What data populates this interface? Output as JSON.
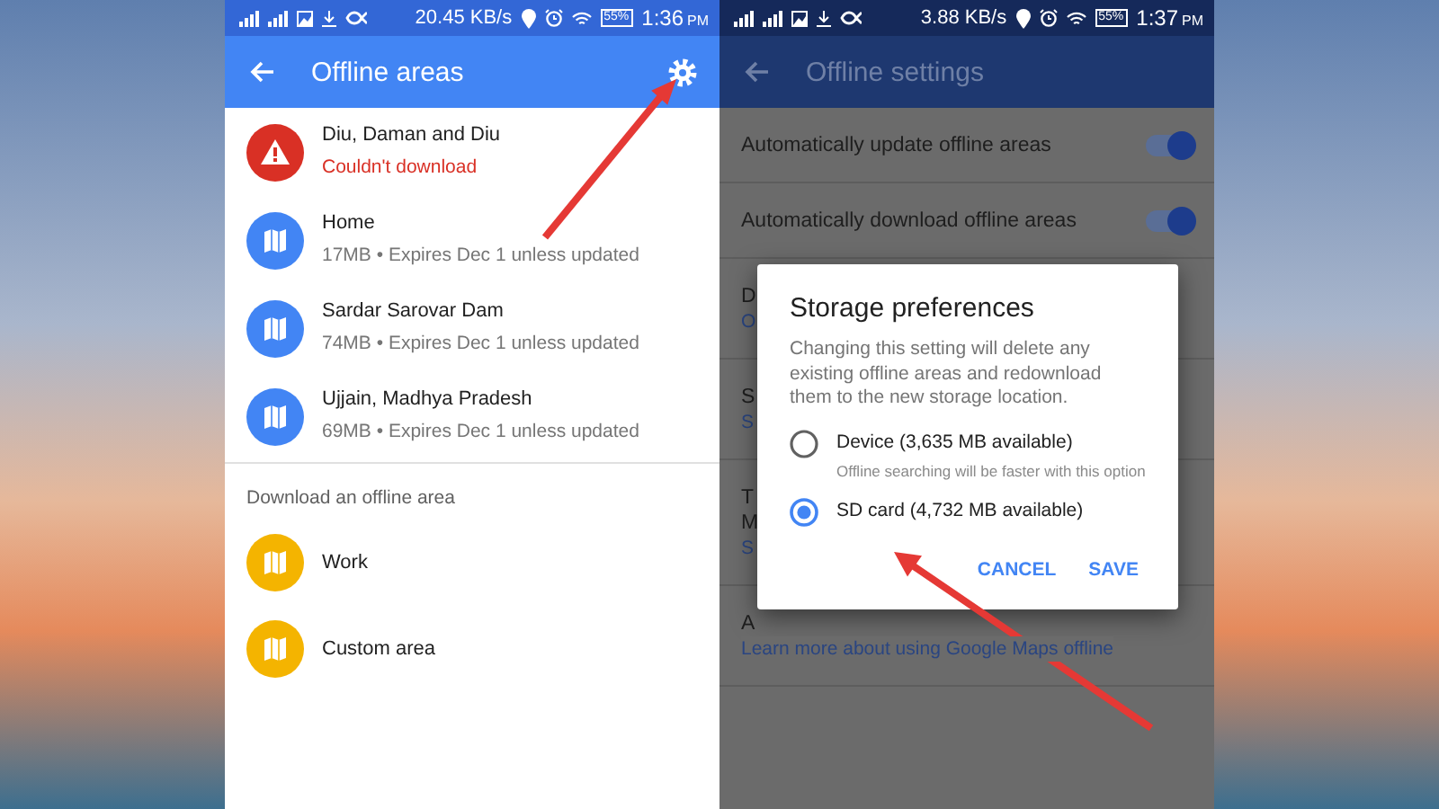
{
  "screens": [
    {
      "kind": "areas",
      "dimmed": false,
      "status_bar": {
        "speed": "20.45 KB/s",
        "battery": "55%",
        "time": "1:36",
        "period": "PM"
      },
      "title": "Offline areas",
      "areas": [
        {
          "name": "Diu, Daman and Diu",
          "detail": "Couldn't download",
          "error": true
        },
        {
          "name": "Home",
          "detail": "17MB • Expires Dec 1 unless updated",
          "error": false
        },
        {
          "name": "Sardar Sarovar Dam",
          "detail": "74MB • Expires Dec 1 unless updated",
          "error": false
        },
        {
          "name": "Ujjain, Madhya Pradesh",
          "detail": "69MB • Expires Dec 1 unless updated",
          "error": false
        }
      ],
      "section": "Download an offline area",
      "download_options": [
        {
          "name": "Work"
        },
        {
          "name": "Custom area"
        }
      ]
    },
    {
      "kind": "settings",
      "dimmed": true,
      "status_bar": {
        "speed": "3.88 KB/s",
        "battery": "55%",
        "time": "1:37",
        "period": "PM"
      },
      "title": "Offline settings",
      "settings": [
        {
          "kind": "toggle",
          "title": "Automatically update offline areas",
          "on": true
        },
        {
          "kind": "toggle",
          "title": "Automatically download offline areas",
          "on": true
        },
        {
          "kind": "text",
          "title": "D",
          "subtitle": "O"
        },
        {
          "kind": "text",
          "title": "S",
          "subtitle": "S"
        },
        {
          "kind": "text",
          "title": "T",
          "title_2": "M",
          "subtitle": "S"
        },
        {
          "kind": "text",
          "title": "A",
          "subtitle": "Learn more about using Google Maps offline"
        }
      ],
      "dialog": {
        "title": "Storage preferences",
        "message": "Changing this setting will delete any existing offline areas and redownload them to the new storage location.",
        "options": [
          {
            "label": "Device (3,635 MB available)",
            "hint": "Offline searching will be faster with this option",
            "selected": false
          },
          {
            "label": "SD card (4,732 MB available)",
            "selected": true
          }
        ],
        "buttons": [
          "CANCEL",
          "SAVE"
        ]
      }
    }
  ]
}
